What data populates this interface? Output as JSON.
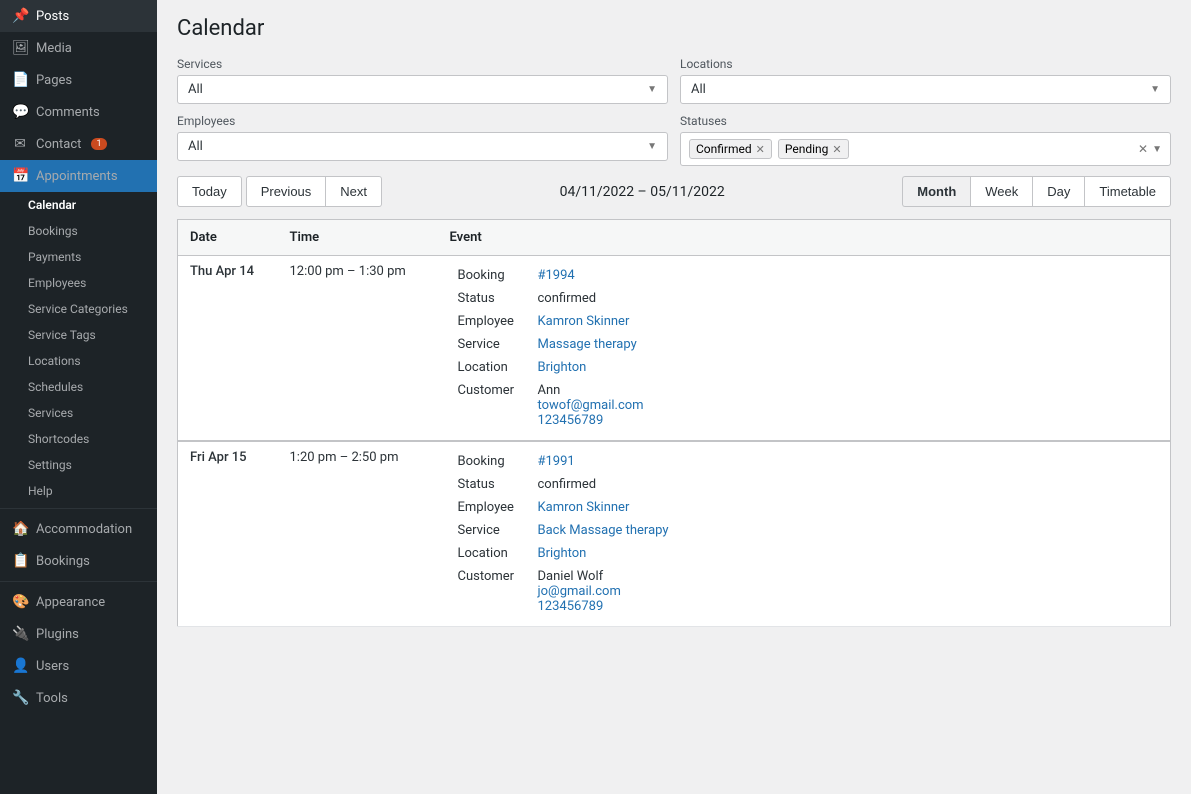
{
  "page": {
    "title": "Calendar"
  },
  "sidebar": {
    "items": [
      {
        "id": "posts",
        "label": "Posts",
        "icon": "📌",
        "active": false
      },
      {
        "id": "media",
        "label": "Media",
        "icon": "🖼",
        "active": false
      },
      {
        "id": "pages",
        "label": "Pages",
        "icon": "📄",
        "active": false
      },
      {
        "id": "comments",
        "label": "Comments",
        "icon": "💬",
        "active": false
      },
      {
        "id": "contact",
        "label": "Contact",
        "icon": "✉",
        "badge": "1",
        "active": false
      },
      {
        "id": "appointments",
        "label": "Appointments",
        "icon": "📅",
        "active": true
      }
    ],
    "appointments_sub": [
      {
        "id": "calendar",
        "label": "Calendar"
      },
      {
        "id": "bookings",
        "label": "Bookings"
      },
      {
        "id": "payments",
        "label": "Payments"
      },
      {
        "id": "employees",
        "label": "Employees"
      },
      {
        "id": "service-categories",
        "label": "Service Categories"
      },
      {
        "id": "service-tags",
        "label": "Service Tags"
      },
      {
        "id": "locations",
        "label": "Locations"
      },
      {
        "id": "schedules",
        "label": "Schedules"
      },
      {
        "id": "services",
        "label": "Services"
      },
      {
        "id": "shortcodes",
        "label": "Shortcodes"
      },
      {
        "id": "settings",
        "label": "Settings"
      },
      {
        "id": "help",
        "label": "Help"
      }
    ],
    "bottom_items": [
      {
        "id": "accommodation",
        "label": "Accommodation",
        "icon": "🏠"
      },
      {
        "id": "bookings-b",
        "label": "Bookings",
        "icon": "📋"
      },
      {
        "id": "appearance",
        "label": "Appearance",
        "icon": "🎨"
      },
      {
        "id": "plugins",
        "label": "Plugins",
        "icon": "🔌"
      },
      {
        "id": "users",
        "label": "Users",
        "icon": "👤"
      },
      {
        "id": "tools",
        "label": "Tools",
        "icon": "🔧"
      }
    ]
  },
  "filters": {
    "services_label": "Services",
    "services_value": "All",
    "locations_label": "Locations",
    "locations_value": "All",
    "employees_label": "Employees",
    "employees_value": "All",
    "statuses_label": "Statuses",
    "statuses_tags": [
      {
        "id": "confirmed",
        "label": "Confirmed"
      },
      {
        "id": "pending",
        "label": "Pending"
      }
    ]
  },
  "calendar_nav": {
    "today_label": "Today",
    "previous_label": "Previous",
    "next_label": "Next",
    "date_range": "04/11/2022 – 05/11/2022",
    "views": [
      {
        "id": "month",
        "label": "Month",
        "active": true
      },
      {
        "id": "week",
        "label": "Week",
        "active": false
      },
      {
        "id": "day",
        "label": "Day",
        "active": false
      },
      {
        "id": "timetable",
        "label": "Timetable",
        "active": false
      }
    ]
  },
  "table": {
    "headers": [
      "Date",
      "Time",
      "Event"
    ],
    "rows": [
      {
        "date": "Thu Apr 14",
        "time": "12:00 pm – 1:30 pm",
        "event": {
          "booking": "#1994",
          "booking_url": "#1994",
          "status": "confirmed",
          "employee": "Kamron Skinner",
          "service": "Massage therapy",
          "location": "Brighton",
          "customer_name": "Ann",
          "customer_email": "towof@gmail.com",
          "customer_phone": "123456789"
        }
      },
      {
        "date": "Fri Apr 15",
        "time": "1:20 pm – 2:50 pm",
        "event": {
          "booking": "#1991",
          "booking_url": "#1991",
          "status": "confirmed",
          "employee": "Kamron Skinner",
          "service": "Back Massage therapy",
          "location": "Brighton",
          "customer_name": "Daniel Wolf",
          "customer_email": "jo@gmail.com",
          "customer_phone": "123456789"
        }
      }
    ]
  }
}
